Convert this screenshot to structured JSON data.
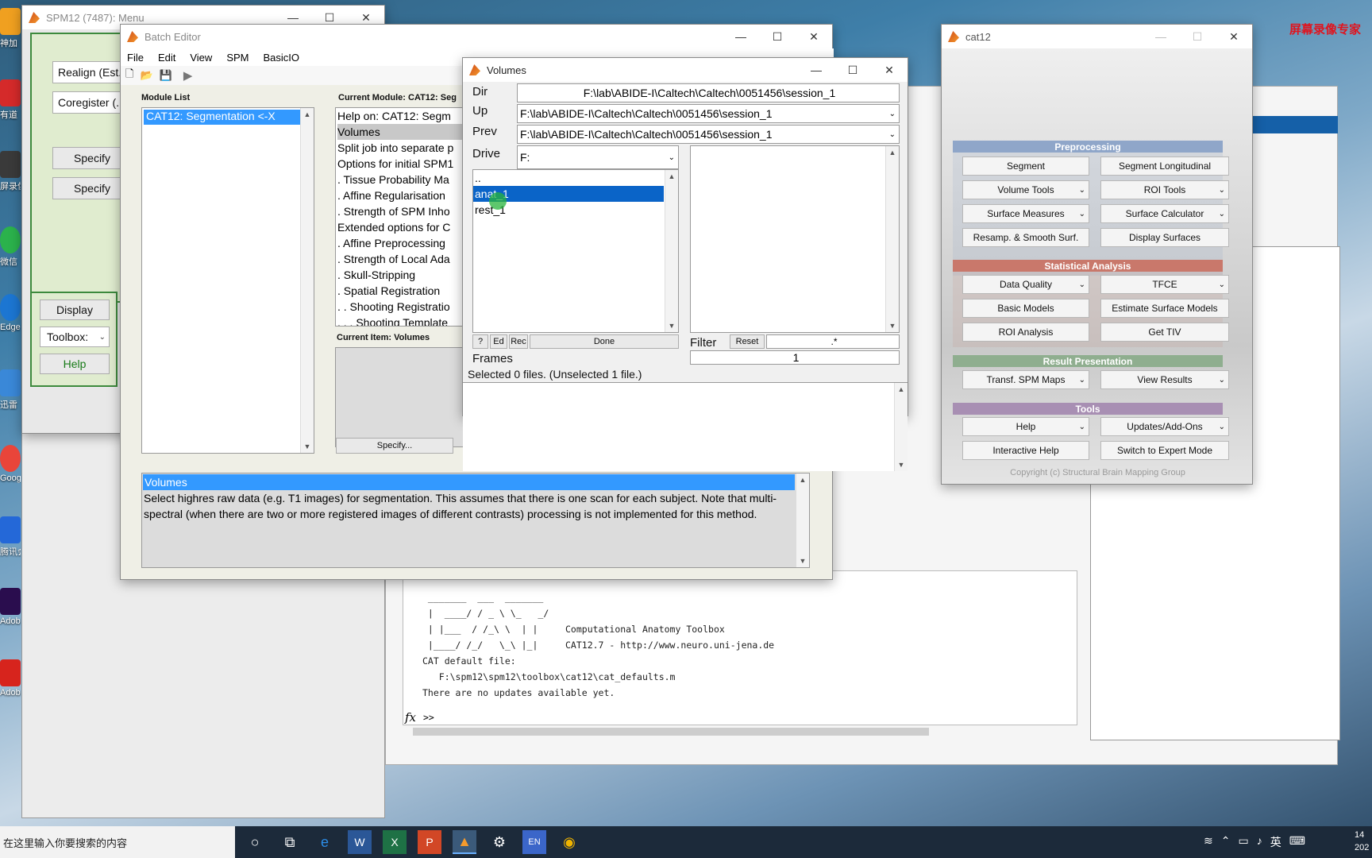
{
  "desktop": {
    "watermark": "屏幕录像专家",
    "icons": [
      "神加",
      "有道",
      "屏录像",
      "微信",
      "Edge",
      "迅雷",
      "Google Chrome",
      "腾讯会",
      "Adobe Premiere",
      "Adobe Professional"
    ]
  },
  "spm_menu": {
    "title": "SPM12 (7487): Menu",
    "realign_label": "Realign (Est...",
    "coregister_label": "Coregister (...",
    "specify1": "Specify",
    "specify2": "Specify",
    "display_label": "Display",
    "toolbox_label": "Toolbox:",
    "help_label": "Help"
  },
  "batch_editor": {
    "title": "Batch Editor",
    "menu": [
      "File",
      "Edit",
      "View",
      "SPM",
      "BasicIO"
    ],
    "module_list_label": "Module List",
    "module_item": "CAT12: Segmentation  <-X",
    "current_module_label": "Current Module: CAT12: Seg",
    "module_lines": [
      "Help on: CAT12: Segm",
      "Volumes",
      "Split job into separate p",
      "Options for initial SPM1",
      ". Tissue Probability Ma",
      ". Affine Regularisation",
      ". Strength of SPM Inho",
      "Extended options for C",
      ". Affine Preprocessing",
      ". Strength of Local Ada",
      ". Skull-Stripping",
      ". Spatial Registration",
      ". . Shooting Registratio",
      ". . . Shooting Template"
    ],
    "current_item_label": "Current Item: Volumes",
    "specify_button": "Specify...",
    "help_heading": "Volumes",
    "help_text": "Select  highres raw data (e.g. T1 images) for segmentation. This assumes that there is one scan for each subject. Note that multi-spectral (when there are two or more registered images of different contrasts) processing is not implemented for this method."
  },
  "volumes": {
    "title": "Volumes",
    "dir_label": "Dir",
    "dir_value": "F:\\lab\\ABIDE-I\\Caltech\\Caltech\\0051456\\session_1",
    "up_label": "Up",
    "up_value": "F:\\lab\\ABIDE-I\\Caltech\\Caltech\\0051456\\session_1",
    "prev_label": "Prev",
    "prev_value": "F:\\lab\\ABIDE-I\\Caltech\\Caltech\\0051456\\session_1",
    "drive_label": "Drive",
    "drive_value": "F:",
    "dirs": [
      "..",
      "anat_1",
      "rest_1"
    ],
    "q_btn": "?",
    "ed_btn": "Ed",
    "rec_btn": "Rec",
    "done_btn": "Done",
    "filter_label": "Filter",
    "reset_btn": "Reset",
    "filter_value": ".*",
    "frames_label": "Frames",
    "frames_value": "1",
    "status": "Selected 0 files. (Unselected 1 file.)"
  },
  "cat12": {
    "title": "cat12",
    "sections": {
      "preprocessing": "Preprocessing",
      "statistical": "Statistical Analysis",
      "result": "Result Presentation",
      "tools": "Tools"
    },
    "buttons": {
      "segment": "Segment",
      "segment_long": "Segment Longitudinal",
      "volume_tools": "Volume Tools",
      "roi_tools": "ROI Tools",
      "surface_measures": "Surface Measures",
      "surface_calc": "Surface Calculator",
      "resamp": "Resamp. & Smooth Surf.",
      "display_surfaces": "Display Surfaces",
      "data_quality": "Data Quality",
      "tfce": "TFCE",
      "basic_models": "Basic Models",
      "estimate_surface": "Estimate Surface Models",
      "roi_analysis": "ROI Analysis",
      "get_tiv": "Get TIV",
      "transf": "Transf. SPM Maps",
      "view_results": "View Results",
      "help": "Help",
      "updates": "Updates/Add-Ons",
      "interactive_help": "Interactive Help",
      "expert_mode": "Switch to Expert Mode"
    },
    "copyright": "Copyright (c) Structural Brain Mapping Group",
    "colors": {
      "pre": "#8fa6c9",
      "stat": "#c9786b",
      "res": "#8fae8f",
      "tools": "#a88fb3"
    }
  },
  "console": {
    "lines": [
      " _______  ___  _______",
      " |  ____/ / _ \\ \\_   _/",
      " | |___  / /_\\ \\  | |     Computational Anatomy Toolbox",
      " |____/ /_/   \\_\\ |_|     CAT12.7 - http://www.neuro.uni-jena.de",
      "",
      "CAT default file:",
      "   F:\\spm12\\spm12\\toolbox\\cat12\\cat_defaults.m",
      "",
      "There are no updates available yet."
    ],
    "prompt": ">>"
  },
  "taskbar": {
    "search_placeholder": "在这里输入你要搜索的内容",
    "tray_lang": "英",
    "time": "14",
    "date": "202"
  }
}
